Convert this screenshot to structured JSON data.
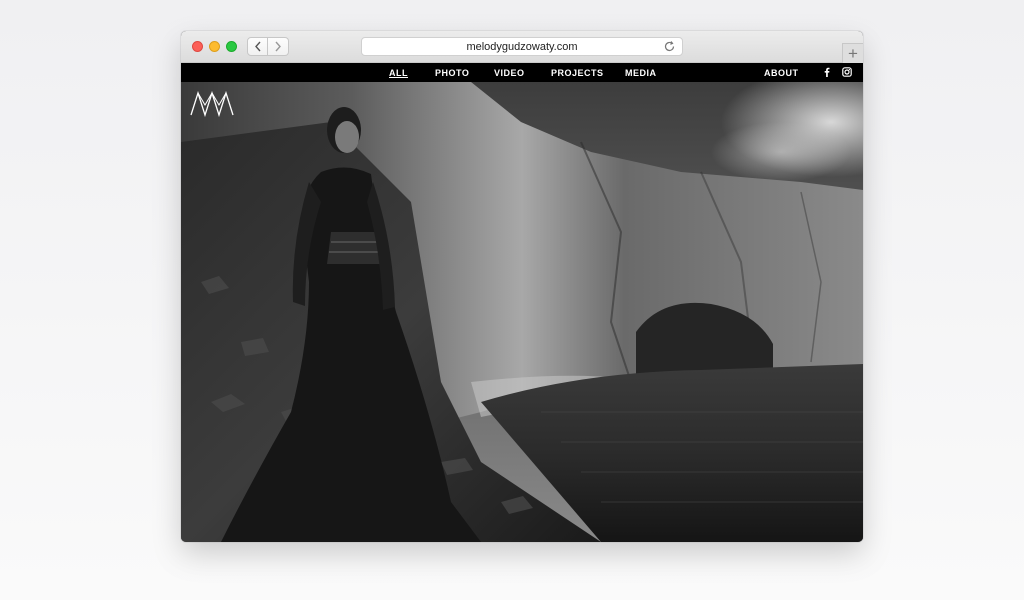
{
  "browser": {
    "url": "melodygudzowaty.com",
    "new_tab_symbol": "+"
  },
  "site": {
    "nav": [
      {
        "label": "ALL",
        "active": true
      },
      {
        "label": "PHOTO",
        "active": false
      },
      {
        "label": "VIDEO",
        "active": false
      },
      {
        "label": "PROJECTS",
        "active": false
      },
      {
        "label": "MEDIA",
        "active": false
      }
    ],
    "about_label": "ABOUT",
    "social_icons": [
      "facebook-icon",
      "instagram-icon"
    ]
  },
  "colors": {
    "nav_bg": "#000000",
    "nav_text": "#ffffff",
    "close": "#fc5f57",
    "minimize": "#fdbb2e",
    "zoom": "#29c841"
  }
}
